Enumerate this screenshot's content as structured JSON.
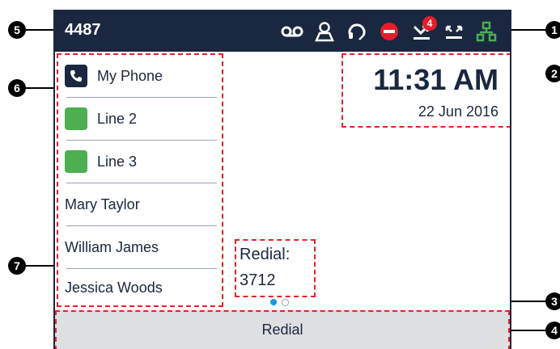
{
  "status_bar": {
    "extension": "4487",
    "icons": [
      "voicemail-icon",
      "contacts-icon",
      "headset-icon",
      "do-not-disturb-icon",
      "missed-calls-icon",
      "call-forward-icon",
      "network-icon"
    ],
    "missed_badge": "4"
  },
  "lines": [
    {
      "label": "My Phone",
      "key": "phone-key-icon",
      "key_color": "#1a2740"
    },
    {
      "label": "Line 2",
      "key": "line-key",
      "key_color": "#4caf50"
    },
    {
      "label": "Line 3",
      "key": "line-key",
      "key_color": "#4caf50"
    },
    {
      "label": "Mary Taylor"
    },
    {
      "label": "William James"
    },
    {
      "label": "Jessica Woods"
    }
  ],
  "clock": {
    "time": "11:31 AM",
    "date": "22 Jun 2016"
  },
  "redial": {
    "label": "Redial:",
    "number": "3712"
  },
  "softkeys": {
    "center": "Redial"
  },
  "callouts": [
    "1",
    "2",
    "3",
    "4",
    "5",
    "6",
    "7"
  ],
  "colors": {
    "header": "#1a2740",
    "accent_red": "#e0242b",
    "line_green": "#4caf50",
    "dot_active": "#1a97e0"
  }
}
